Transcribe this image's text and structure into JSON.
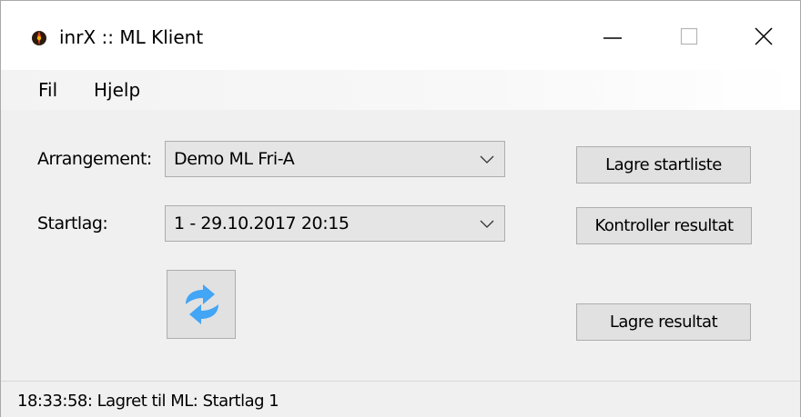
{
  "window": {
    "title": "inrX :: ML Klient",
    "icon": "inrx-app-icon",
    "controls": [
      "minimize-icon",
      "maximize-icon",
      "close-icon"
    ]
  },
  "menu": {
    "items": [
      {
        "label": "Fil"
      },
      {
        "label": "Hjelp"
      }
    ]
  },
  "form": {
    "arrangement": {
      "label": "Arrangement:",
      "value": "Demo ML Fri-A"
    },
    "startlag": {
      "label": "Startlag:",
      "value": "1 - 29.10.2017 20:15"
    },
    "refresh_icon": "refresh-icon"
  },
  "buttons": {
    "lagre_startliste": "Lagre startliste",
    "kontroller_resultat": "Kontroller resultat",
    "lagre_resultat": "Lagre resultat"
  },
  "status": {
    "text": "18:33:58: Lagret til ML: Startlag 1"
  },
  "colors": {
    "accent_blue": "#42a5f5",
    "window_bg": "#f0f0f0",
    "button_bg": "#e1e1e1"
  }
}
